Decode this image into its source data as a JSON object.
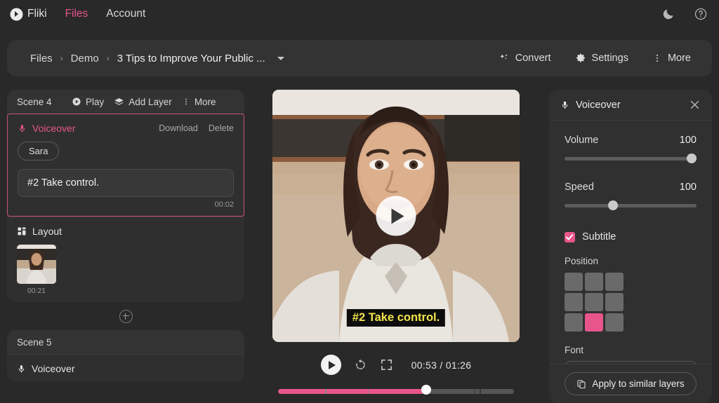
{
  "topnav": {
    "brand": "Fliki",
    "brand_icon": "play-badge-icon",
    "items": [
      {
        "label": "Files",
        "active": true
      },
      {
        "label": "Account",
        "active": false
      }
    ],
    "right_icons": [
      {
        "name": "moon-icon",
        "label": "Dark mode"
      },
      {
        "name": "help-circle-icon",
        "label": "Help"
      }
    ],
    "accent": "#e8568c"
  },
  "breadcrumb": {
    "items": [
      "Files",
      "Demo",
      "3 Tips to Improve Your Public ..."
    ],
    "separator": "›",
    "dropdown_icon": "chevron-down-icon",
    "actions": [
      {
        "label": "Convert",
        "icon": "sparkles-icon"
      },
      {
        "label": "Settings",
        "icon": "gear-icon"
      },
      {
        "label": "More",
        "icon": "dots-vertical-icon"
      }
    ]
  },
  "scenes": [
    {
      "name": "Scene 4",
      "actions": [
        {
          "label": "Play",
          "icon": "play-circle-icon"
        },
        {
          "label": "Add Layer",
          "icon": "layers-icon"
        },
        {
          "label": "More",
          "icon": "dots-vertical-icon"
        }
      ],
      "layers": [
        {
          "type": "voiceover",
          "title": "Voiceover",
          "icon": "microphone-icon",
          "active": true,
          "actions": [
            "Download",
            "Delete"
          ],
          "voice_chip": "Sara",
          "text": "#2 Take control.",
          "duration": "00:02"
        },
        {
          "type": "layout",
          "title": "Layout",
          "icon": "layout-grid-icon",
          "active": false,
          "thumb_duration": "00:21"
        }
      ]
    },
    {
      "name": "Scene 5",
      "layers": [
        {
          "type": "voiceover",
          "title": "Voiceover",
          "icon": "microphone-icon"
        }
      ]
    }
  ],
  "add_scene": {
    "icon": "plus-circle-icon",
    "label": "Add scene"
  },
  "preview": {
    "caption": "#2 Take control.",
    "caption_color": "#f2e44a",
    "overlay_play_icon": "play-icon",
    "controls": {
      "play_icon": "play-icon",
      "replay_icon": "rotate-left-icon",
      "fullscreen_icon": "expand-icon",
      "current_time": "00:53",
      "total_time": "01:26",
      "time_display": "00:53 / 01:26",
      "progress_percent": 62,
      "track_color": "#e8558b"
    }
  },
  "inspector": {
    "title": "Voiceover",
    "title_icon": "microphone-icon",
    "close_icon": "close-icon",
    "volume": {
      "label": "Volume",
      "value": "100",
      "percent": 100
    },
    "speed": {
      "label": "Speed",
      "value": "100",
      "percent": 35
    },
    "subtitle": {
      "label": "Subtitle",
      "checked": true
    },
    "position": {
      "label": "Position",
      "cells": [
        "top-left",
        "top-center",
        "top-right",
        "middle-left",
        "middle-center",
        "middle-right",
        "bottom-left",
        "bottom-center",
        "bottom-right"
      ],
      "selected": "bottom-center",
      "selected_color": "#e8558b"
    },
    "font": {
      "label": "Font"
    },
    "apply_button": {
      "label": "Apply to similar layers",
      "icon": "copy-icon"
    }
  }
}
